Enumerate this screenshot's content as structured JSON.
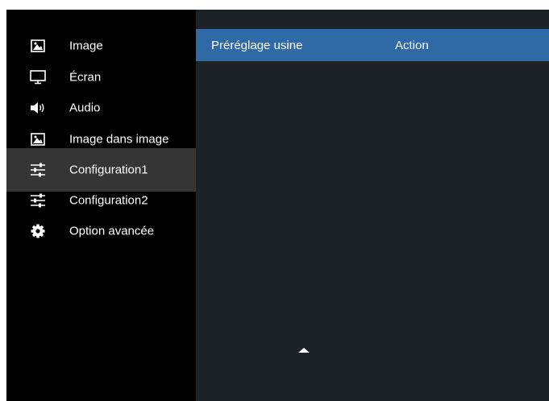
{
  "sidebar": {
    "items": [
      {
        "label": "Image",
        "icon": "picture-icon"
      },
      {
        "label": "Écran",
        "icon": "monitor-icon"
      },
      {
        "label": "Audio",
        "icon": "speaker-icon"
      },
      {
        "label": "Image dans image",
        "icon": "picture-icon"
      },
      {
        "label": "Configuration1",
        "icon": "sliders-icon",
        "selected": true
      },
      {
        "label": "Configuration2",
        "icon": "sliders-icon"
      },
      {
        "label": "Option avancée",
        "icon": "gear-icon"
      }
    ]
  },
  "panel": {
    "rows": [
      {
        "label": "Préréglage usine",
        "value": "Action",
        "highlighted": true
      }
    ]
  },
  "colors": {
    "highlight": "#2f6aa7",
    "panel_bg": "#1c2228",
    "selected_bg": "#353535"
  }
}
